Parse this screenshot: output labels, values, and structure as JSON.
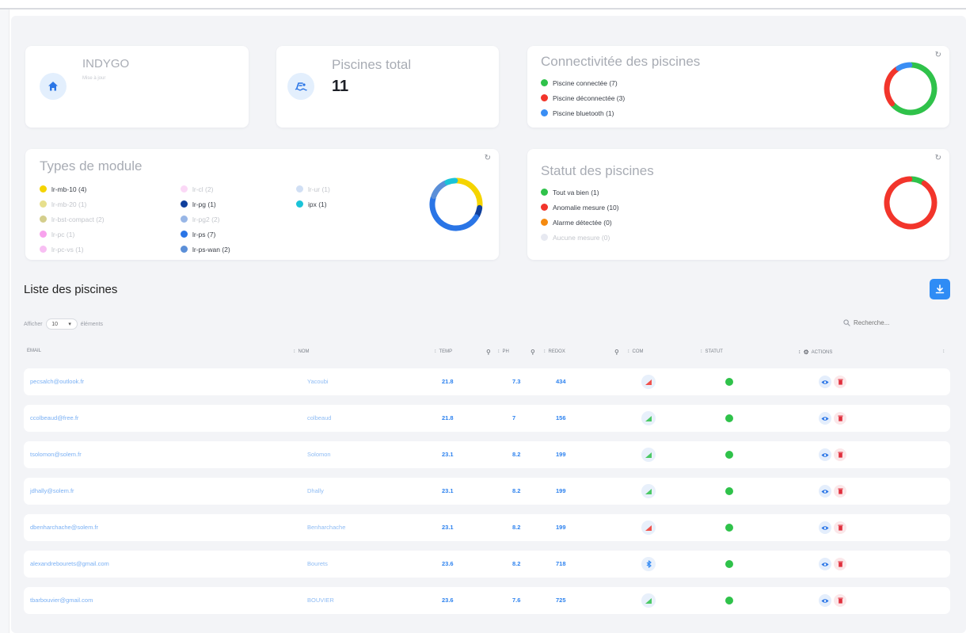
{
  "org": {
    "name": "INDYGO",
    "subtitle": "Mise à jour"
  },
  "pools_total": {
    "title": "Piscines total",
    "count": "11"
  },
  "connectivity": {
    "title": "Connectivitée des piscines",
    "items": [
      {
        "label": "Piscine connectée (7)",
        "color": "#2fc24a"
      },
      {
        "label": "Piscine déconnectée (3)",
        "color": "#f2352b"
      },
      {
        "label": "Piscine bluetooth (1)",
        "color": "#3a8ef4"
      }
    ]
  },
  "modules": {
    "title": "Types de module",
    "col1": [
      {
        "label": "lr-mb-10 (4)",
        "color": "#f5d400",
        "faded": false
      },
      {
        "label": "lr-mb-20 (1)",
        "color": "#c9b800",
        "faded": true
      },
      {
        "label": "lr-bst-compact (2)",
        "color": "#a09300",
        "faded": true
      },
      {
        "label": "lr-pc (1)",
        "color": "#f030d8",
        "faded": true
      },
      {
        "label": "lr-pc-vs (1)",
        "color": "#f070e4",
        "faded": true
      }
    ],
    "col2": [
      {
        "label": "lr-cl (2)",
        "color": "#f7a8ec",
        "faded": true
      },
      {
        "label": "lr-pg (1)",
        "color": "#0f3f9c",
        "faded": false
      },
      {
        "label": "lr-pg2 (2)",
        "color": "#1a5ec8",
        "faded": true
      },
      {
        "label": "lr-ps (7)",
        "color": "#2a75e6",
        "faded": false
      },
      {
        "label": "lr-ps-wan (2)",
        "color": "#5b8fd8",
        "faded": false
      }
    ],
    "col3": [
      {
        "label": "lr-ur (1)",
        "color": "#9ab9e6",
        "faded": true
      },
      {
        "label": "ipx (1)",
        "color": "#1ac3d8",
        "faded": false
      }
    ]
  },
  "status": {
    "title": "Statut des piscines",
    "items": [
      {
        "label": "Tout va bien (1)",
        "color": "#2fc24a",
        "faded": false
      },
      {
        "label": "Anomalie mesure (10)",
        "color": "#f2352b",
        "faded": false
      },
      {
        "label": "Alarme détectée (0)",
        "color": "#f58a10",
        "faded": false
      },
      {
        "label": "Aucune mesure (0)",
        "color": "#c9cfe0",
        "faded": true
      }
    ]
  },
  "list": {
    "title": "Liste des piscines",
    "show_prefix": "Afficher",
    "show_value": "10",
    "show_suffix": "éléments",
    "search_placeholder": "Recherche..."
  },
  "table": {
    "headers": {
      "email": "Email",
      "nom": "Nom",
      "temp": "Temp",
      "ph": "PH",
      "redox": "Redox",
      "com": "Com",
      "statut": "Statut",
      "actions": "Actions"
    },
    "rows": [
      {
        "email": "pecsalch@outlook.fr",
        "nom": "Yacoubi",
        "temp": "21.8",
        "ph": "7.3",
        "redox": "434",
        "com": "signal",
        "com_color": "#f2352b"
      },
      {
        "email": "ccolbeaud@free.fr",
        "nom": "colbeaud",
        "temp": "21.8",
        "ph": "7",
        "redox": "156",
        "com": "signal",
        "com_color": "#2fc24a"
      },
      {
        "email": "tsolomon@solem.fr",
        "nom": "Solomon",
        "temp": "23.1",
        "ph": "8.2",
        "redox": "199",
        "com": "signal",
        "com_color": "#2fc24a"
      },
      {
        "email": "jdhally@solem.fr",
        "nom": "Dhally",
        "temp": "23.1",
        "ph": "8.2",
        "redox": "199",
        "com": "signal",
        "com_color": "#2fc24a"
      },
      {
        "email": "dbenharchache@solem.fr",
        "nom": "Benharchache",
        "temp": "23.1",
        "ph": "8.2",
        "redox": "199",
        "com": "signal",
        "com_color": "#f2352b"
      },
      {
        "email": "alexandrebourets@gmail.com",
        "nom": "Bourets",
        "temp": "23.6",
        "ph": "8.2",
        "redox": "718",
        "com": "bluetooth",
        "com_color": "#3a8ef4"
      },
      {
        "email": "tbarbouvier@gmail.com",
        "nom": "BOUVIER",
        "temp": "23.6",
        "ph": "7.6",
        "redox": "725",
        "com": "signal",
        "com_color": "#2fc24a"
      }
    ]
  },
  "charts": {
    "connectivity_donut": [
      {
        "value": 7,
        "color": "#2fc24a"
      },
      {
        "value": 3,
        "color": "#f2352b"
      },
      {
        "value": 1,
        "color": "#3a8ef4"
      }
    ],
    "modules_donut": [
      {
        "value": 4,
        "color": "#f5d400"
      },
      {
        "value": 1,
        "color": "#0f3f9c"
      },
      {
        "value": 7,
        "color": "#2a75e6"
      },
      {
        "value": 2,
        "color": "#5b8fd8"
      },
      {
        "value": 1,
        "color": "#1ac3d8"
      }
    ],
    "status_donut": [
      {
        "value": 1,
        "color": "#2fc24a"
      },
      {
        "value": 10,
        "color": "#f2352b"
      }
    ]
  }
}
